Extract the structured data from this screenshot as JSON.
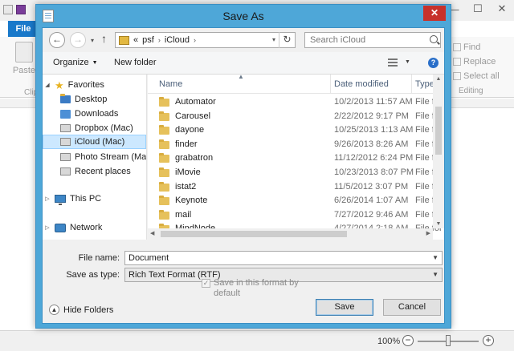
{
  "background_app": {
    "file_tab": "File",
    "paste_label": "Paste",
    "clipboard_group": "Clip",
    "editing": {
      "find": "Find",
      "replace": "Replace",
      "select_all": "Select all",
      "group_label": "Editing"
    },
    "status": {
      "zoom": "100%",
      "zoom_out": "−",
      "zoom_in": "+",
      "zoom_level": 0.5
    },
    "window_controls": {
      "minimize": "—",
      "maximize": "☐",
      "close": "✕"
    }
  },
  "dialog": {
    "title": "Save As",
    "close_glyph": "✕",
    "nav": {
      "back": "←",
      "forward": "→",
      "up": "↑",
      "history_dropdown": "▾"
    },
    "address": {
      "overflow": "«",
      "segments": [
        "psf",
        "iCloud"
      ],
      "separator": "›",
      "dropdown": "▾",
      "refresh": "↻"
    },
    "search": {
      "placeholder": "Search iCloud"
    },
    "toolbar": {
      "organize": "Organize",
      "new_folder": "New folder",
      "help": "?"
    },
    "navigation_pane": {
      "favorites": {
        "label": "Favorites",
        "items": [
          "Desktop",
          "Downloads",
          "Dropbox (Mac)",
          "iCloud (Mac)",
          "Photo Stream (Mac)",
          "Recent places"
        ]
      },
      "selected": "iCloud (Mac)",
      "this_pc": "This PC",
      "network": "Network"
    },
    "file_list": {
      "columns": {
        "name": "Name",
        "date": "Date modified",
        "type": "Type"
      },
      "rows": [
        {
          "name": "Automator",
          "date": "10/2/2013 11:57 AM",
          "type": "File fol"
        },
        {
          "name": "Carousel",
          "date": "2/22/2012 9:17 PM",
          "type": "File fol"
        },
        {
          "name": "dayone",
          "date": "10/25/2013 1:13 AM",
          "type": "File fol"
        },
        {
          "name": "finder",
          "date": "9/26/2013 8:26 AM",
          "type": "File fol"
        },
        {
          "name": "grabatron",
          "date": "11/12/2012 6:24 PM",
          "type": "File fol"
        },
        {
          "name": "iMovie",
          "date": "10/23/2013 8:07 PM",
          "type": "File fol"
        },
        {
          "name": "istat2",
          "date": "11/5/2012 3:07 PM",
          "type": "File fol"
        },
        {
          "name": "Keynote",
          "date": "6/26/2014 1:07 AM",
          "type": "File fol"
        },
        {
          "name": "mail",
          "date": "7/27/2012 9:46 AM",
          "type": "File fol"
        },
        {
          "name": "MindNode",
          "date": "4/27/2014 2:18 AM",
          "type": "File fol"
        }
      ]
    },
    "form": {
      "file_name_label": "File name:",
      "file_name_value": "Document",
      "save_type_label": "Save as type:",
      "save_type_value": "Rich Text Format (RTF)",
      "save_default_checkbox": "Save in this format by default",
      "save_default_checked": true,
      "checkmark": "✓"
    },
    "buttons": {
      "save": "Save",
      "cancel": "Cancel",
      "hide_folders": "Hide Folders",
      "hide_folders_glyph": "▲"
    }
  }
}
